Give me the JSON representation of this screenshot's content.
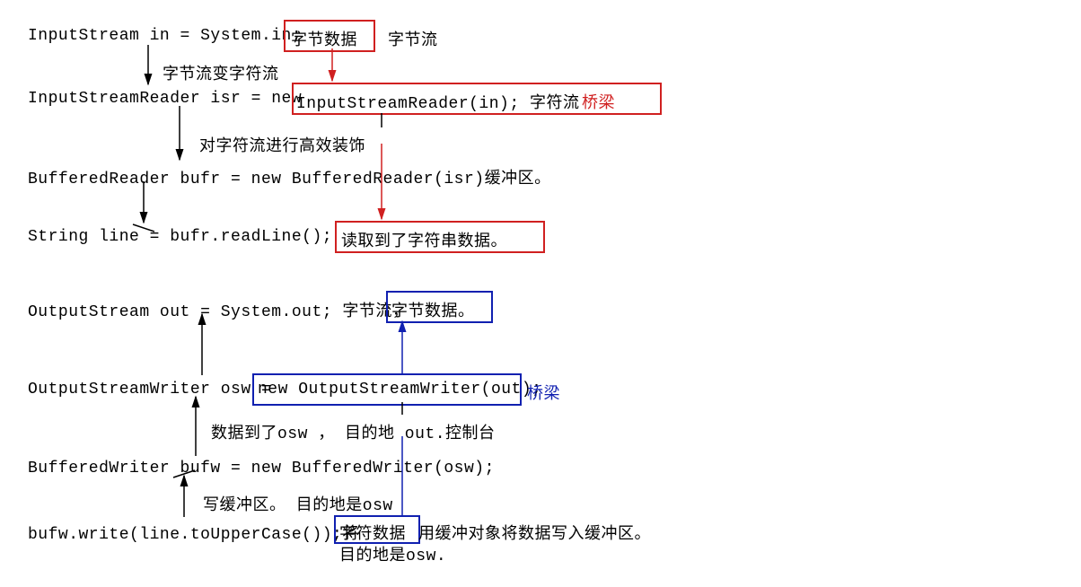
{
  "lines": {
    "in_decl": "InputStream in = System.in;",
    "byte_data": "字节数据",
    "byte_stream": "字节流",
    "byte_to_char": "字节流变字符流",
    "isr_decl_lhs": "InputStreamReader isr = new",
    "isr_decl_rhs": "InputStreamReader(in); 字符流",
    "bridge1": "桥梁",
    "decorate": "对字符流进行高效装饰",
    "bufr_decl": "BufferedReader bufr = new BufferedReader(isr)缓冲区。",
    "readline": "String line = bufr.readLine();",
    "read_string": "读取到了字符串数据。",
    "out_decl": "OutputStream out = System.out;  字节流，",
    "byte_data2": "字节数据。",
    "osw_lhs": "OutputStreamWriter osw =",
    "osw_rhs": "new OutputStreamWriter(out);",
    "bridge2": "桥梁",
    "data_to_osw": "数据到了osw ， 目的地 out.控制台",
    "bufw_decl": "BufferedWriter  bufw = new BufferedWriter(osw);",
    "write_buffer": "写缓冲区。 目的地是osw",
    "write_call_pre": "bufw.write(line.toUpperCase());将",
    "char_data": "字符数据",
    "write_call_post": "用缓冲对象将数据写入缓冲区。",
    "dest_osw": "目的地是osw."
  }
}
